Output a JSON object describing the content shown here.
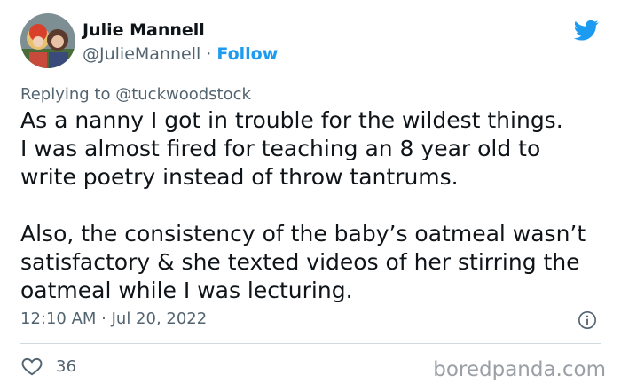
{
  "author": {
    "name": "Julie Mannell",
    "handle": "@JulieMannell",
    "separator": " · ",
    "follow_label": "Follow",
    "avatar": "avatar-photo"
  },
  "brand_icon": "twitter-bird-icon",
  "reply": {
    "prefix": "Replying to ",
    "mention": "@tuckwoodstock"
  },
  "tweet": {
    "paragraphs": [
      "As a nanny I got in trouble for the wildest things.\nI was almost fired for teaching an 8 year old to\nwrite poetry instead of throw tantrums.",
      "Also, the consistency of the baby’s oatmeal wasn’t\nsatisfactory & she texted videos of her stirring the\noatmeal while I was lecturing."
    ],
    "timestamp": "12:10 AM · Jul 20, 2022",
    "info_icon": "info-icon"
  },
  "engagement": {
    "like_icon": "heart-icon",
    "like_count": "36"
  },
  "watermark": "boredpanda.com",
  "colors": {
    "accent": "#1d9bf0",
    "text": "#0f1419",
    "muted": "#536471",
    "divider": "#cfd9de"
  }
}
